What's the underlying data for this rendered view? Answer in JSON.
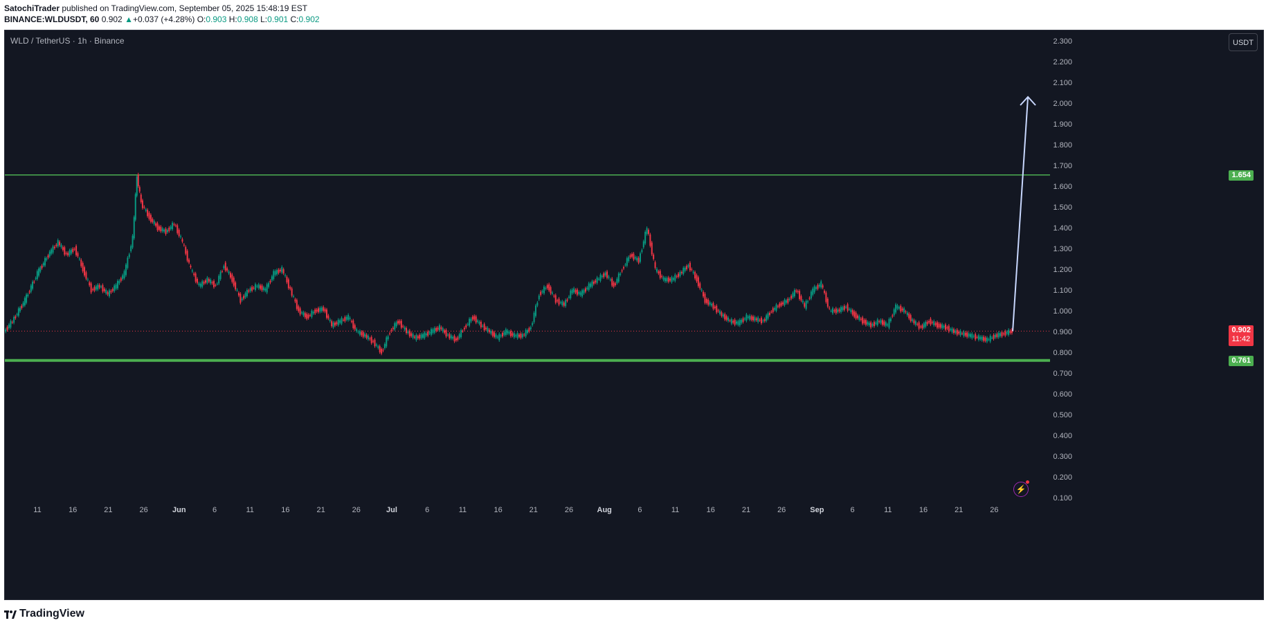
{
  "header": {
    "author": "SatochiTrader",
    "published": "published on TradingView.com, September 05, 2025 15:48:19 EST",
    "symbol": "BINANCE:WLDUSDT, 60",
    "last": "0.902",
    "change_arrow": "▲",
    "change": "+0.037 (+4.28%)",
    "o_label": "O:",
    "o_value": "0.903",
    "h_label": "H:",
    "h_value": "0.908",
    "l_label": "L:",
    "l_value": "0.901",
    "c_label": "C:",
    "c_value": "0.902"
  },
  "chart_title": "WLD / TetherUS · 1h · Binance",
  "currency_button": "USDT",
  "badges": {
    "resistance": "1.654",
    "current_price": "0.902",
    "countdown": "11:42",
    "support": "0.761"
  },
  "footer": {
    "brand": "TradingView"
  },
  "colors": {
    "background": "#131722",
    "up": "#089981",
    "down": "#f23645",
    "level_line": "#4caf50",
    "arrow": "#c9d8ff",
    "grid_text": "#b2b5be"
  },
  "chart_data": {
    "type": "line",
    "series": [
      {
        "values": [
          [
            0,
            0.9
          ],
          [
            2,
            0.95
          ],
          [
            5,
            1.05
          ],
          [
            8,
            1.18
          ],
          [
            11,
            1.28
          ],
          [
            13,
            1.33
          ],
          [
            15,
            1.27
          ],
          [
            17,
            1.3
          ],
          [
            19,
            1.2
          ],
          [
            21,
            1.1
          ],
          [
            23,
            1.12
          ],
          [
            25,
            1.08
          ],
          [
            27,
            1.12
          ],
          [
            29,
            1.18
          ],
          [
            31,
            1.35
          ],
          [
            32,
            1.65
          ],
          [
            33,
            1.52
          ],
          [
            35,
            1.45
          ],
          [
            37,
            1.4
          ],
          [
            39,
            1.38
          ],
          [
            41,
            1.42
          ],
          [
            43,
            1.33
          ],
          [
            45,
            1.2
          ],
          [
            47,
            1.12
          ],
          [
            49,
            1.15
          ],
          [
            51,
            1.12
          ],
          [
            53,
            1.22
          ],
          [
            55,
            1.15
          ],
          [
            57,
            1.05
          ],
          [
            59,
            1.1
          ],
          [
            61,
            1.12
          ],
          [
            63,
            1.1
          ],
          [
            65,
            1.18
          ],
          [
            67,
            1.2
          ],
          [
            69,
            1.1
          ],
          [
            71,
            1.0
          ],
          [
            73,
            0.97
          ],
          [
            75,
            1.0
          ],
          [
            77,
            1.01
          ],
          [
            79,
            0.93
          ],
          [
            81,
            0.95
          ],
          [
            83,
            0.97
          ],
          [
            85,
            0.9
          ],
          [
            87,
            0.88
          ],
          [
            89,
            0.85
          ],
          [
            91,
            0.8
          ],
          [
            93,
            0.9
          ],
          [
            95,
            0.95
          ],
          [
            97,
            0.9
          ],
          [
            99,
            0.87
          ],
          [
            101,
            0.88
          ],
          [
            103,
            0.9
          ],
          [
            105,
            0.92
          ],
          [
            107,
            0.88
          ],
          [
            109,
            0.86
          ],
          [
            111,
            0.92
          ],
          [
            113,
            0.97
          ],
          [
            115,
            0.93
          ],
          [
            117,
            0.9
          ],
          [
            119,
            0.87
          ],
          [
            121,
            0.9
          ],
          [
            123,
            0.88
          ],
          [
            125,
            0.88
          ],
          [
            127,
            0.92
          ],
          [
            129,
            1.08
          ],
          [
            131,
            1.12
          ],
          [
            133,
            1.05
          ],
          [
            135,
            1.03
          ],
          [
            137,
            1.1
          ],
          [
            139,
            1.08
          ],
          [
            141,
            1.12
          ],
          [
            143,
            1.15
          ],
          [
            145,
            1.18
          ],
          [
            147,
            1.12
          ],
          [
            149,
            1.2
          ],
          [
            151,
            1.27
          ],
          [
            153,
            1.24
          ],
          [
            155,
            1.4
          ],
          [
            157,
            1.2
          ],
          [
            159,
            1.15
          ],
          [
            161,
            1.15
          ],
          [
            163,
            1.18
          ],
          [
            165,
            1.22
          ],
          [
            167,
            1.15
          ],
          [
            169,
            1.05
          ],
          [
            171,
            1.02
          ],
          [
            173,
            0.98
          ],
          [
            175,
            0.95
          ],
          [
            177,
            0.94
          ],
          [
            179,
            0.97
          ],
          [
            181,
            0.96
          ],
          [
            183,
            0.95
          ],
          [
            185,
            1.0
          ],
          [
            187,
            1.03
          ],
          [
            189,
            1.05
          ],
          [
            191,
            1.1
          ],
          [
            193,
            1.02
          ],
          [
            195,
            1.1
          ],
          [
            197,
            1.13
          ],
          [
            199,
            1.0
          ],
          [
            201,
            1.0
          ],
          [
            203,
            1.02
          ],
          [
            205,
            0.98
          ],
          [
            207,
            0.95
          ],
          [
            209,
            0.93
          ],
          [
            211,
            0.95
          ],
          [
            213,
            0.93
          ],
          [
            215,
            1.02
          ],
          [
            217,
            1.0
          ],
          [
            219,
            0.95
          ],
          [
            221,
            0.92
          ],
          [
            223,
            0.95
          ],
          [
            225,
            0.93
          ],
          [
            227,
            0.92
          ],
          [
            229,
            0.9
          ],
          [
            231,
            0.89
          ],
          [
            233,
            0.88
          ],
          [
            235,
            0.87
          ],
          [
            237,
            0.86
          ],
          [
            239,
            0.88
          ],
          [
            241,
            0.89
          ],
          [
            243,
            0.902
          ]
        ]
      }
    ],
    "y_ticks": [
      "2.300",
      "2.200",
      "2.100",
      "2.000",
      "1.900",
      "1.800",
      "1.700",
      "1.600",
      "1.500",
      "1.400",
      "1.300",
      "1.200",
      "1.100",
      "1.000",
      "0.900",
      "0.800",
      "0.700",
      "0.600",
      "0.500",
      "0.400",
      "0.300",
      "0.200",
      "0.100"
    ],
    "y_tick_values": [
      2.3,
      2.2,
      2.1,
      2.0,
      1.9,
      1.8,
      1.7,
      1.6,
      1.5,
      1.4,
      1.3,
      1.2,
      1.1,
      1.0,
      0.9,
      0.8,
      0.7,
      0.6,
      0.5,
      0.4,
      0.3,
      0.2,
      0.1
    ],
    "x_ticks": [
      "11",
      "16",
      "21",
      "26",
      "Jun",
      "6",
      "11",
      "16",
      "21",
      "26",
      "Jul",
      "6",
      "11",
      "16",
      "21",
      "26",
      "Aug",
      "6",
      "11",
      "16",
      "21",
      "26",
      "Sep",
      "6",
      "11",
      "16",
      "21",
      "26"
    ],
    "ylim": [
      0.05,
      2.35
    ],
    "levels": [
      1.654,
      0.761
    ],
    "current_price": 0.902,
    "projection": {
      "from": [
        243,
        0.902
      ],
      "to": [
        245,
        2.03
      ]
    }
  }
}
